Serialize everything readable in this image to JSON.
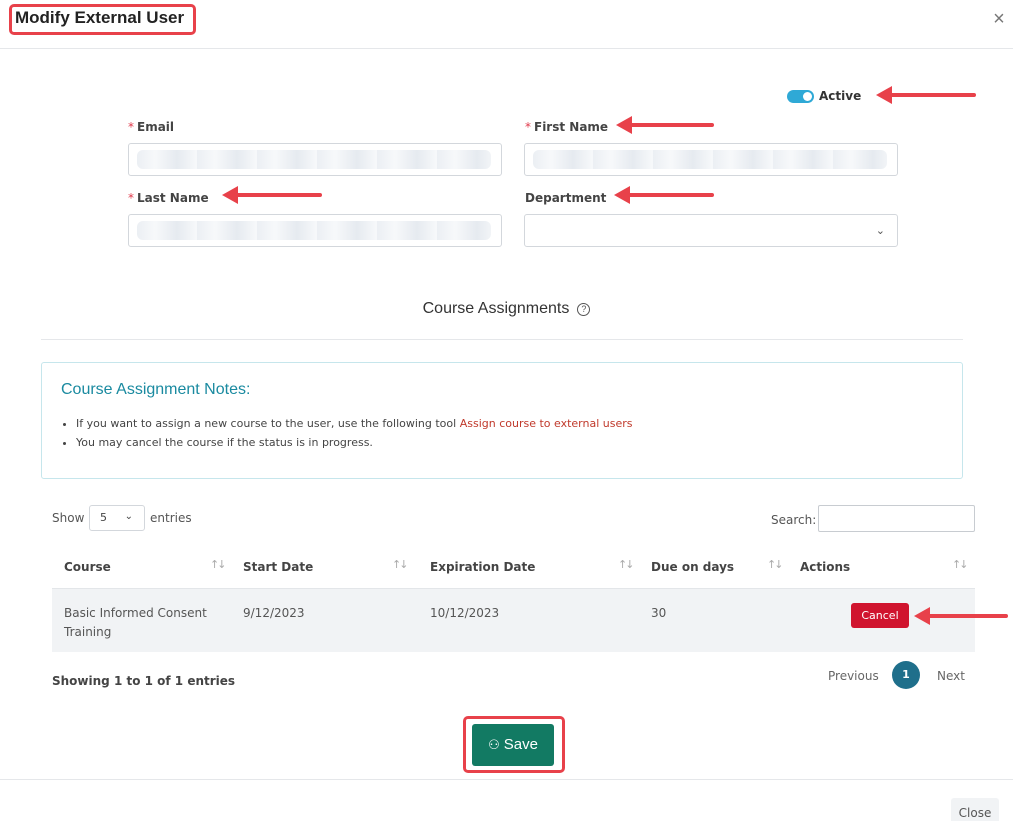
{
  "modal": {
    "title": "Modify External User",
    "close_icon": "close-icon"
  },
  "status": {
    "active_label": "Active",
    "active": true
  },
  "form": {
    "email_label": "Email",
    "first_name_label": "First Name",
    "last_name_label": "Last Name",
    "department_label": "Department",
    "required_mark": "*",
    "dropdown_icon": "chevron-down-icon"
  },
  "course_assignments": {
    "title": "Course Assignments",
    "help_icon": "question-circle-icon",
    "help_glyph": "?"
  },
  "notes": {
    "title": "Course Assignment Notes:",
    "item1_text": "If you want to assign a new course to the user, use the following tool ",
    "item1_link": "Assign course to external users",
    "item2_text": "You may cancel the course if the status is in progress."
  },
  "table_controls": {
    "show_label": "Show",
    "page_size": "5",
    "entries_label": "entries",
    "search_label": "Search:"
  },
  "table": {
    "headers": [
      "Course",
      "Start Date",
      "Expiration Date",
      "Due on days",
      "Actions"
    ],
    "sort_glyph": "↑↓",
    "rows": [
      {
        "course": "Basic Informed Consent Training",
        "start_date": "9/12/2023",
        "expiration_date": "10/12/2023",
        "due_on_days": "30",
        "action": "Cancel"
      }
    ]
  },
  "pagination": {
    "summary": "Showing 1 to 1 of 1 entries",
    "previous": "Previous",
    "current_page": "1",
    "next": "Next"
  },
  "footer": {
    "save_label": "Save",
    "save_icon": "user-edit-icon",
    "close_label": "Close"
  },
  "colors": {
    "annotation": "#e8414a",
    "toggle": "#2fa9d6",
    "save": "#127a63",
    "cancel": "#d0142e",
    "notes_title": "#1a8aa0",
    "page_active": "#1f6f8b"
  }
}
